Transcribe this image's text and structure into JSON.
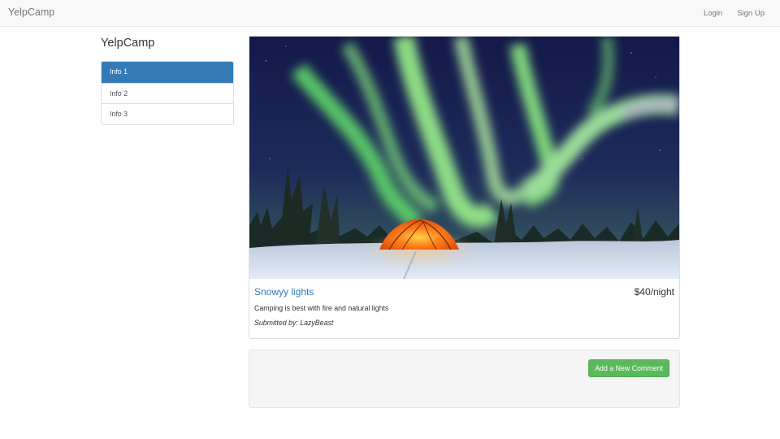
{
  "navbar": {
    "brand": "YelpCamp",
    "links": [
      {
        "label": "Login"
      },
      {
        "label": "Sign Up"
      }
    ]
  },
  "sidebar": {
    "title": "YelpCamp",
    "items": [
      {
        "label": "Info 1",
        "active": true
      },
      {
        "label": "Info 2",
        "active": false
      },
      {
        "label": "Info 3",
        "active": false
      }
    ]
  },
  "campground": {
    "image_subject": "aurora borealis over snowy forest with orange tent",
    "name": "Snowyy lights",
    "price": "$40/night",
    "description": "Camping is best with fire and natural lights",
    "submitted_by": "Submitted by: LazyBeast"
  },
  "comments": {
    "add_button_label": "Add a New Comment"
  },
  "colors": {
    "primary": "#337ab7",
    "success": "#5cb85c",
    "navbar_bg": "#f8f8f8"
  }
}
